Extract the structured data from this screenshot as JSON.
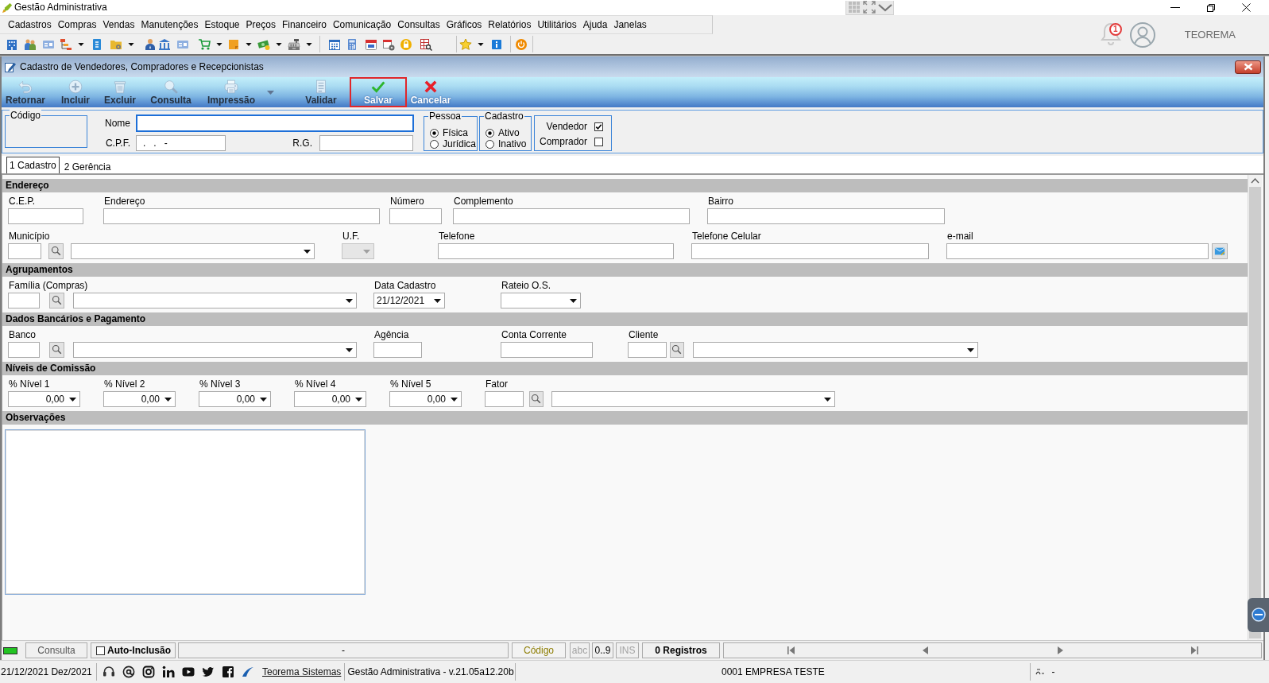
{
  "window": {
    "title": "Gestão Administrativa"
  },
  "menu": [
    "Cadastros",
    "Compras",
    "Vendas",
    "Manutenções",
    "Estoque",
    "Preços",
    "Financeiro",
    "Comunicação",
    "Consultas",
    "Gráficos",
    "Relatórios",
    "Utilitários",
    "Ajuda",
    "Janelas"
  ],
  "notifications": {
    "count": "1"
  },
  "user": {
    "name": "TEOREMA"
  },
  "form_window": {
    "title": "Cadastro de Vendedores, Compradores e Recepcionistas",
    "actions": [
      {
        "kind": "return",
        "label": "Retornar",
        "disabled": true,
        "highlighted": false,
        "dropdown": false
      },
      {
        "kind": "add",
        "label": "Incluir",
        "disabled": true,
        "highlighted": false,
        "dropdown": false
      },
      {
        "kind": "delete",
        "label": "Excluir",
        "disabled": true,
        "highlighted": false,
        "dropdown": false
      },
      {
        "kind": "query",
        "label": "Consulta",
        "disabled": true,
        "highlighted": false,
        "dropdown": false
      },
      {
        "kind": "print",
        "label": "Impressão",
        "disabled": true,
        "highlighted": false,
        "dropdown": true
      },
      {
        "kind": "validate",
        "label": "Validar",
        "disabled": true,
        "highlighted": false,
        "dropdown": false
      },
      {
        "kind": "save",
        "label": "Salvar",
        "disabled": false,
        "highlighted": true,
        "dropdown": false
      },
      {
        "kind": "cancel",
        "label": "Cancelar",
        "disabled": false,
        "highlighted": false,
        "dropdown": false
      }
    ],
    "header": {
      "code": {
        "legend": "Código"
      },
      "name": {
        "label": "Nome",
        "focused": true
      },
      "cpf": {
        "label": "C.P.F.",
        "value": ".   .   -"
      },
      "rg": {
        "label": "R.G."
      },
      "groups": [
        {
          "legend": "Pessoa",
          "options": [
            {
              "label": "Física",
              "selected": true
            },
            {
              "label": "Jurídica",
              "selected": false
            }
          ]
        },
        {
          "legend": "Cadastro",
          "options": [
            {
              "label": "Ativo",
              "selected": true
            },
            {
              "label": "Inativo",
              "selected": false
            }
          ]
        }
      ],
      "roles": [
        {
          "label": "Vendedor",
          "checked": true
        },
        {
          "label": "Comprador",
          "checked": false
        }
      ]
    },
    "tabs": [
      {
        "label": "1 Cadastro",
        "selected": true
      },
      {
        "label": "2 Gerência",
        "selected": false
      }
    ],
    "sections": [
      {
        "title": "Endereço",
        "fields": [
          {
            "kind": "text",
            "label": "C.E.P.",
            "disabled": false
          },
          {
            "kind": "text",
            "label": "Endereço",
            "disabled": false
          },
          {
            "kind": "text",
            "label": "Número",
            "disabled": false
          },
          {
            "kind": "text",
            "label": "Complemento",
            "disabled": false
          },
          {
            "kind": "text",
            "label": "Bairro",
            "disabled": false
          },
          {
            "kind": "lookup",
            "label": "Município",
            "disabled": false
          },
          {
            "kind": "combo",
            "label": "U.F.",
            "disabled": true
          },
          {
            "kind": "text",
            "label": "Telefone",
            "disabled": false
          },
          {
            "kind": "text",
            "label": "Telefone Celular",
            "disabled": false
          },
          {
            "kind": "email",
            "label": "e-mail",
            "disabled": false
          }
        ]
      },
      {
        "title": "Agrupamentos",
        "fields": [
          {
            "kind": "lookup",
            "label": "Família (Compras)",
            "disabled": false
          },
          {
            "kind": "combo",
            "label": "Data Cadastro",
            "value": "21/12/2021",
            "disabled": false
          },
          {
            "kind": "combo",
            "label": "Rateio O.S.",
            "disabled": false
          }
        ]
      },
      {
        "title": "Dados Bancários e Pagamento",
        "fields": [
          {
            "kind": "lookup",
            "label": "Banco",
            "disabled": false
          },
          {
            "kind": "text",
            "label": "Agência",
            "disabled": false
          },
          {
            "kind": "text",
            "label": "Conta Corrente",
            "disabled": false
          },
          {
            "kind": "lookup",
            "label": "Cliente",
            "disabled": false
          }
        ]
      },
      {
        "title": "Níveis de Comissão",
        "fields": [
          {
            "kind": "spin",
            "label": "% Nível 1",
            "value": "0,00",
            "disabled": false
          },
          {
            "kind": "spin",
            "label": "% Nível 2",
            "value": "0,00",
            "disabled": false
          },
          {
            "kind": "spin",
            "label": "% Nível 3",
            "value": "0,00",
            "disabled": false
          },
          {
            "kind": "spin",
            "label": "% Nível 4",
            "value": "0,00",
            "disabled": false
          },
          {
            "kind": "spin",
            "label": "% Nível 5",
            "value": "0,00",
            "disabled": false
          },
          {
            "kind": "lookup",
            "label": "Fator",
            "disabled": false
          }
        ]
      },
      {
        "title": "Observações",
        "fields": [
          {
            "kind": "memo",
            "disabled": false
          }
        ]
      }
    ],
    "status_bar": {
      "mode": "Consulta",
      "auto_inclusion": {
        "label": "Auto-Inclusão",
        "checked": false
      },
      "message": "-",
      "sort_field": "Código",
      "indicators": [
        {
          "label": "abc",
          "on": false
        },
        {
          "label": "0..9",
          "on": true
        },
        {
          "label": "INS",
          "on": false
        }
      ],
      "records": "0 Registros"
    }
  },
  "footer": {
    "date": "21/12/2021 Dez/2021",
    "link": "Teorema Sistemas",
    "version": "Gestão Administrativa - v.21.05a12.20b",
    "company": "0001 EMPRESA TESTE",
    "indicator": "-"
  }
}
